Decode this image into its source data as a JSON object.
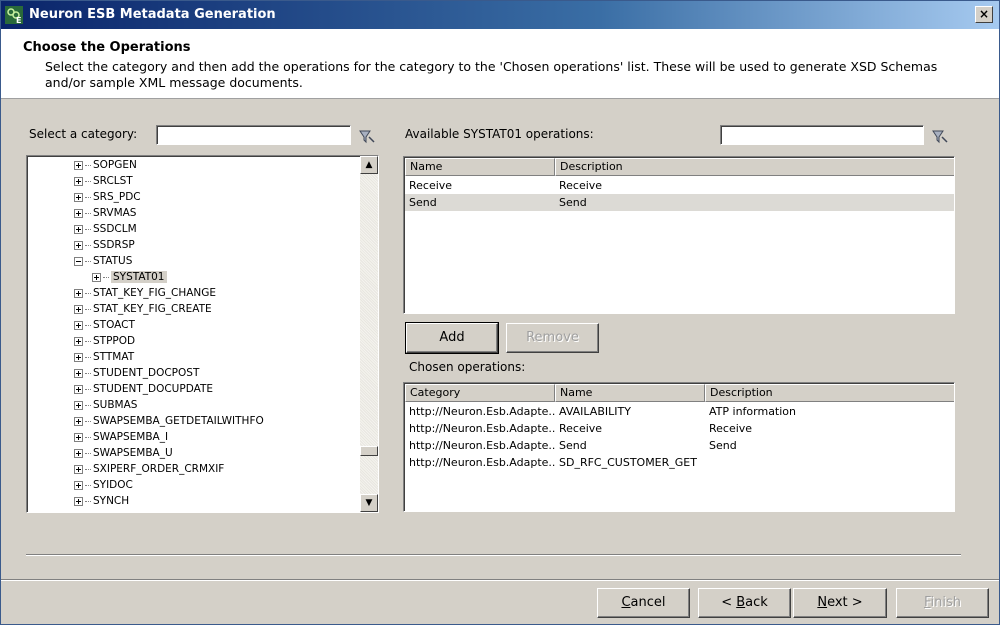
{
  "window": {
    "title": "Neuron ESB Metadata Generation",
    "close_label": "×"
  },
  "header": {
    "title": "Choose the Operations",
    "description": "Select the category and then add the operations for the category to the 'Chosen operations' list. These will be used to generate XSD Schemas and/or sample XML message documents."
  },
  "category": {
    "label": "Select a category:",
    "filter_value": ""
  },
  "tree": {
    "items": [
      {
        "label": "SOPGEN",
        "level": 0,
        "expanded": false
      },
      {
        "label": "SRCLST",
        "level": 0,
        "expanded": false
      },
      {
        "label": "SRS_PDC",
        "level": 0,
        "expanded": false
      },
      {
        "label": "SRVMAS",
        "level": 0,
        "expanded": false
      },
      {
        "label": "SSDCLM",
        "level": 0,
        "expanded": false
      },
      {
        "label": "SSDRSP",
        "level": 0,
        "expanded": false
      },
      {
        "label": "STATUS",
        "level": 0,
        "expanded": true
      },
      {
        "label": "SYSTAT01",
        "level": 1,
        "expanded": false,
        "selected": true
      },
      {
        "label": "STAT_KEY_FIG_CHANGE",
        "level": 0,
        "expanded": false
      },
      {
        "label": "STAT_KEY_FIG_CREATE",
        "level": 0,
        "expanded": false
      },
      {
        "label": "STOACT",
        "level": 0,
        "expanded": false
      },
      {
        "label": "STPPOD",
        "level": 0,
        "expanded": false
      },
      {
        "label": "STTMAT",
        "level": 0,
        "expanded": false
      },
      {
        "label": "STUDENT_DOCPOST",
        "level": 0,
        "expanded": false
      },
      {
        "label": "STUDENT_DOCUPDATE",
        "level": 0,
        "expanded": false
      },
      {
        "label": "SUBMAS",
        "level": 0,
        "expanded": false
      },
      {
        "label": "SWAPSEMBA_GETDETAILWITHFO",
        "level": 0,
        "expanded": false
      },
      {
        "label": "SWAPSEMBA_I",
        "level": 0,
        "expanded": false
      },
      {
        "label": "SWAPSEMBA_U",
        "level": 0,
        "expanded": false
      },
      {
        "label": "SXIPERF_ORDER_CRMXIF",
        "level": 0,
        "expanded": false
      },
      {
        "label": "SYIDOC",
        "level": 0,
        "expanded": false
      },
      {
        "label": "SYNCH",
        "level": 0,
        "expanded": false
      }
    ],
    "scroll_up": "▲",
    "scroll_down": "▼"
  },
  "available": {
    "label": "Available SYSTAT01 operations:",
    "filter_value": "",
    "columns": [
      "Name",
      "Description"
    ],
    "rows": [
      {
        "name": "Receive",
        "description": "Receive"
      },
      {
        "name": "Send",
        "description": "Send",
        "highlight": true
      }
    ]
  },
  "actions": {
    "add_label": "Add",
    "remove_label": "Remove"
  },
  "chosen": {
    "label": "Chosen operations:",
    "columns": [
      "Category",
      "Name",
      "Description"
    ],
    "rows": [
      {
        "category": "http://Neuron.Esb.Adapte...",
        "name": "AVAILABILITY",
        "description": "ATP information"
      },
      {
        "category": "http://Neuron.Esb.Adapte...",
        "name": "Receive",
        "description": "Receive"
      },
      {
        "category": "http://Neuron.Esb.Adapte...",
        "name": "Send",
        "description": "Send"
      },
      {
        "category": "http://Neuron.Esb.Adapte...",
        "name": "SD_RFC_CUSTOMER_GET",
        "description": ""
      }
    ]
  },
  "footer": {
    "cancel_accel": "C",
    "cancel_rest": "ancel",
    "back_prefix": "< ",
    "back_accel": "B",
    "back_rest": "ack",
    "next_accel": "N",
    "next_rest": "ext >",
    "finish_accel": "F",
    "finish_rest": "inish"
  },
  "colors": {
    "titlebar_start": "#0a246a",
    "titlebar_end": "#a6caf0",
    "dialog_bg": "#d4d0c8"
  }
}
